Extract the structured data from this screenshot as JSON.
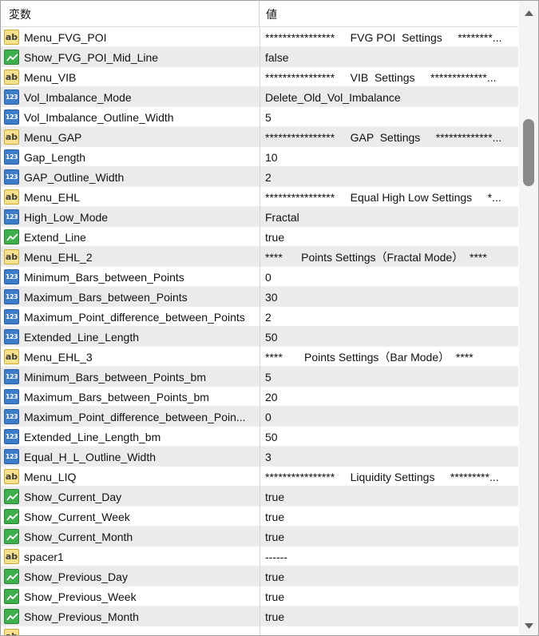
{
  "header": {
    "name": "変数",
    "value": "値"
  },
  "rows": [
    {
      "type": "ab",
      "name": "Menu_FVG_POI",
      "value": "****************     FVG POI  Settings     ********..."
    },
    {
      "type": "bool",
      "name": "Show_FVG_POI_Mid_Line",
      "value": "false"
    },
    {
      "type": "ab",
      "name": "Menu_VIB",
      "value": "****************     VIB  Settings     *************..."
    },
    {
      "type": "num",
      "name": "Vol_Imbalance_Mode",
      "value": "Delete_Old_Vol_Imbalance"
    },
    {
      "type": "num",
      "name": "Vol_Imbalance_Outline_Width",
      "value": "5"
    },
    {
      "type": "ab",
      "name": "Menu_GAP",
      "value": "****************     GAP  Settings     *************..."
    },
    {
      "type": "num",
      "name": "Gap_Length",
      "value": "10"
    },
    {
      "type": "num",
      "name": "GAP_Outline_Width",
      "value": "2"
    },
    {
      "type": "ab",
      "name": "Menu_EHL",
      "value": "****************     Equal High Low Settings     *..."
    },
    {
      "type": "num",
      "name": "High_Low_Mode",
      "value": "Fractal"
    },
    {
      "type": "bool",
      "name": "Extend_Line",
      "value": "true"
    },
    {
      "type": "ab",
      "name": "Menu_EHL_2",
      "value": "****      Points Settings（Fractal Mode）  ****"
    },
    {
      "type": "num",
      "name": "Minimum_Bars_between_Points",
      "value": "0"
    },
    {
      "type": "num",
      "name": "Maximum_Bars_between_Points",
      "value": "30"
    },
    {
      "type": "num",
      "name": "Maximum_Point_difference_between_Points",
      "value": "2"
    },
    {
      "type": "num",
      "name": "Extended_Line_Length",
      "value": "50"
    },
    {
      "type": "ab",
      "name": "Menu_EHL_3",
      "value": "****       Points Settings（Bar Mode）  ****"
    },
    {
      "type": "num",
      "name": "Minimum_Bars_between_Points_bm",
      "value": "5"
    },
    {
      "type": "num",
      "name": "Maximum_Bars_between_Points_bm",
      "value": "20"
    },
    {
      "type": "num",
      "name": "Maximum_Point_difference_between_Poin...",
      "value": "0"
    },
    {
      "type": "num",
      "name": "Extended_Line_Length_bm",
      "value": "50"
    },
    {
      "type": "num",
      "name": "Equal_H_L_Outline_Width",
      "value": "3"
    },
    {
      "type": "ab",
      "name": "Menu_LIQ",
      "value": "****************     Liquidity Settings     *********..."
    },
    {
      "type": "bool",
      "name": "Show_Current_Day",
      "value": "true"
    },
    {
      "type": "bool",
      "name": "Show_Current_Week",
      "value": "true"
    },
    {
      "type": "bool",
      "name": "Show_Current_Month",
      "value": "true"
    },
    {
      "type": "ab",
      "name": "spacer1",
      "value": "------"
    },
    {
      "type": "bool",
      "name": "Show_Previous_Day",
      "value": "true"
    },
    {
      "type": "bool",
      "name": "Show_Previous_Week",
      "value": "true"
    },
    {
      "type": "bool",
      "name": "Show_Previous_Month",
      "value": "true"
    },
    {
      "type": "ab",
      "name": "",
      "value": ""
    }
  ],
  "icons": {
    "ab": "string-type-icon",
    "num": "integer-type-icon",
    "bool": "boolean-type-icon"
  },
  "colors": {
    "alt_row": "#ebebeb",
    "ab_icon": "#f5e18c",
    "num_icon": "#3d7cc9",
    "bool_icon": "#3fae4c",
    "scroll_thumb": "#8a8a8a"
  }
}
